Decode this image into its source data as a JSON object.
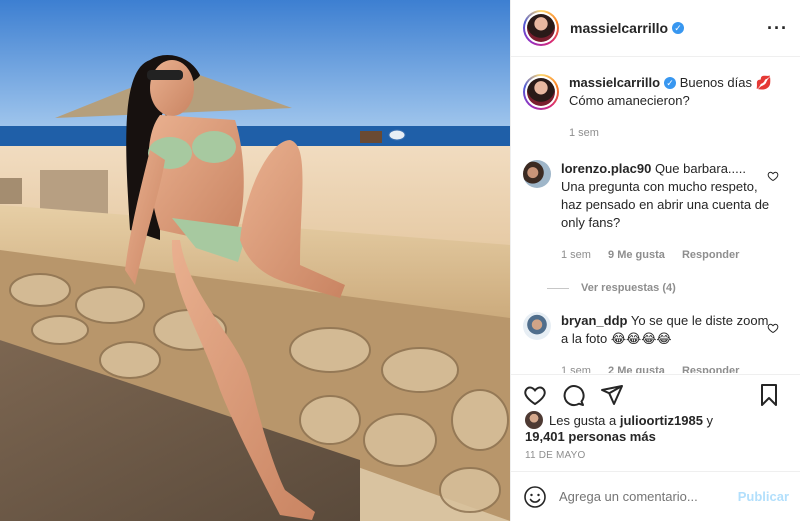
{
  "post": {
    "username": "massielcarrillo",
    "verified_icon": "verified-check-icon",
    "more_icon": "ellipsis-icon"
  },
  "caption": {
    "username": "massielcarrillo",
    "text": "Buenos días 💋 Cómo amanecieron?",
    "time": "1 sem"
  },
  "comments": [
    {
      "username": "lorenzo.plac90",
      "text": "Que barbara..... Una pregunta con mucho respeto, haz pensado en abrir una cuenta de only fans?",
      "time": "1 sem",
      "likes": "9 Me gusta",
      "reply": "Responder",
      "view_replies": "Ver respuestas (4)"
    },
    {
      "username": "bryan_ddp",
      "text": "Yo se que le diste zoom a la foto 😂😂😂😂",
      "time": "1 sem",
      "likes": "2 Me gusta",
      "reply": "Responder"
    }
  ],
  "actions": {
    "like_icon": "heart-icon",
    "comment_icon": "comment-icon",
    "share_icon": "paper-plane-icon",
    "save_icon": "bookmark-icon"
  },
  "likes": {
    "prefix": "Les gusta a",
    "user": "julioortiz1985",
    "connector": "y",
    "others": "19,401 personas más"
  },
  "date": "11 DE MAYO",
  "add_comment": {
    "placeholder": "Agrega un comentario...",
    "post_label": "Publicar",
    "emoji_icon": "smiley-icon"
  },
  "colors": {
    "verified": "#3897f0",
    "publish_disabled": "#b2dffc",
    "muted": "#8e8e8e",
    "text": "#262626"
  }
}
